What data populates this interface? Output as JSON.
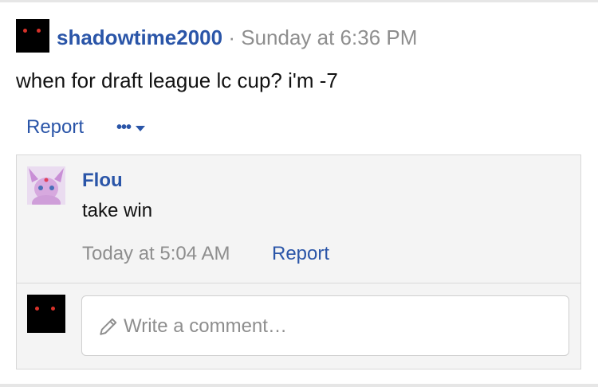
{
  "post": {
    "avatar_icon": "shadow-avatar-icon",
    "username": "shadowtime2000",
    "separator": "·",
    "time": "Sunday at 6:36 PM",
    "text": "when for draft league lc cup? i'm -7",
    "actions": {
      "report_label": "Report",
      "more_label": "•••",
      "more_icon": "caret-down-icon"
    }
  },
  "comments": [
    {
      "avatar_icon": "espeon-avatar-icon",
      "author": "Flou",
      "text": "take win",
      "time": "Today at 5:04 AM",
      "report_label": "Report"
    }
  ],
  "comment_writer": {
    "avatar_icon": "shadow-avatar-icon",
    "icon": "pencil-icon",
    "placeholder": "Write a comment…"
  },
  "colors": {
    "link": "#2a55a8",
    "muted": "#8e8e8e",
    "avatar_eyes": "#d8322a"
  }
}
